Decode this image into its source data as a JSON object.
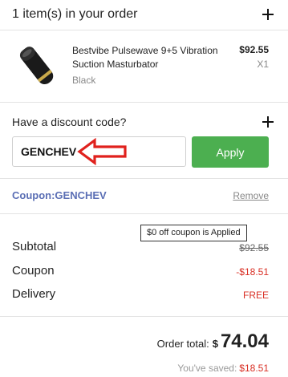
{
  "cart": {
    "header_title": "1 item(s) in your order",
    "item": {
      "name": "Bestvibe Pulsewave 9+5 Vibration Suction Masturbator",
      "variant": "Black",
      "price": "$92.55",
      "quantity": "X1"
    }
  },
  "discount": {
    "label": "Have a discount code?",
    "code_value": "GENCHEV",
    "apply_label": "Apply",
    "applied_coupon": "Coupon:GENCHEV",
    "remove_label": "Remove",
    "tooltip": "$0 off coupon is Applied"
  },
  "summary": {
    "subtotal_label": "Subtotal",
    "subtotal_value": "$92.55",
    "coupon_label": "Coupon",
    "coupon_value": "-$18.51",
    "delivery_label": "Delivery",
    "delivery_value": "FREE",
    "order_total_label": "Order total:",
    "order_total_currency": "$",
    "order_total_amount": "74.04",
    "saved_label": "You've saved:",
    "saved_amount": "$18.51"
  },
  "colors": {
    "apply_button": "#4caf50",
    "coupon_text": "#5b6fb5",
    "discount_red": "#d93025",
    "annotation_arrow": "#e0211d"
  },
  "icons": {
    "header_expand": "plus-icon",
    "discount_expand": "plus-icon",
    "annotation": "left-arrow-annotation"
  }
}
